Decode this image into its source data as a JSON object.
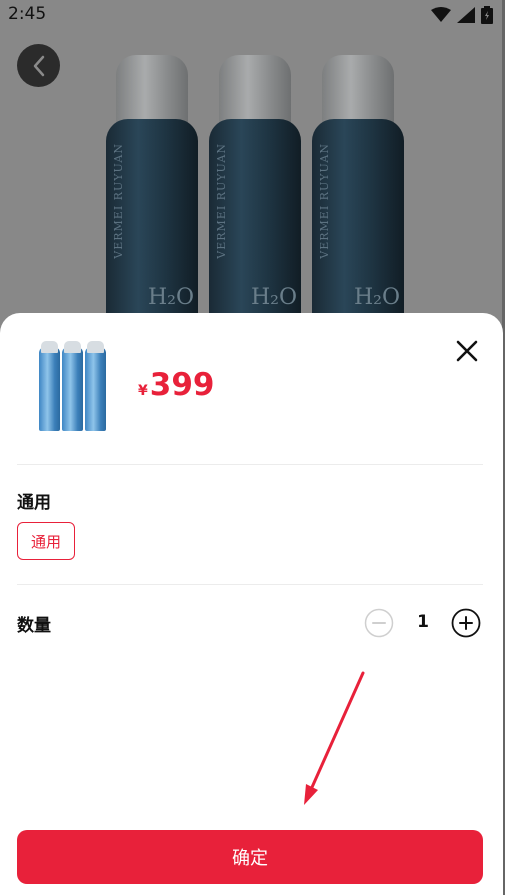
{
  "status_bar": {
    "time": "2:45"
  },
  "background_product": {
    "can_text": "VERMEI RUYUAN",
    "can_label": "H₂O"
  },
  "sheet": {
    "price_currency": "¥",
    "price_value": "399",
    "spec_section_label": "通用",
    "spec_option_label": "通用",
    "quantity_label": "数量",
    "quantity_value": "1",
    "confirm_label": "确定"
  },
  "colors": {
    "accent": "#e8213a",
    "overlay": "#8a8a8a",
    "thumb_can": "#5aa2d8"
  },
  "icons": [
    "back-icon",
    "wifi-icon",
    "signal-icon",
    "battery-icon",
    "close-icon",
    "minus-icon",
    "plus-icon",
    "arrow-annotation"
  ]
}
